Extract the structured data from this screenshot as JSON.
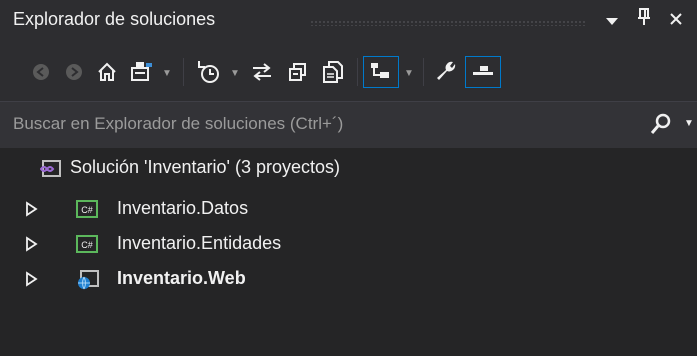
{
  "panel": {
    "title": "Explorador de soluciones",
    "pin_label": "p",
    "close_label": "✕"
  },
  "toolbar": {
    "icons": [
      "back-icon",
      "forward-icon",
      "home-icon",
      "switch-views-icon",
      "pending-changes-icon",
      "sync-icon",
      "collapse-all-icon",
      "show-all-files-icon",
      "preview-icon",
      "properties-icon",
      "preview-selected-icon"
    ]
  },
  "search": {
    "placeholder": "Buscar en Explorador de soluciones (Ctrl+´)"
  },
  "tree": {
    "solution_label": "Solución 'Inventario'  (3 proyectos)",
    "projects": [
      {
        "label": "Inventario.Datos",
        "type": "csharp"
      },
      {
        "label": "Inventario.Entidades",
        "type": "csharp"
      },
      {
        "label": "Inventario.Web",
        "type": "web",
        "bold": true
      }
    ]
  },
  "colors": {
    "background": "#252526",
    "toolbar": "#2d2d30",
    "search": "#333337",
    "accent": "#007acc",
    "text": "#f1f1f1",
    "placeholder": "#9b9b9b"
  }
}
